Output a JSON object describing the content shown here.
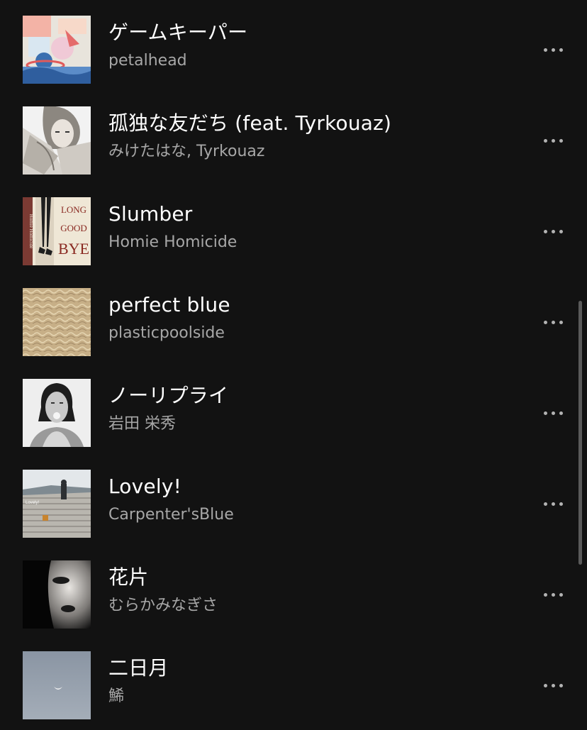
{
  "tracks": [
    {
      "title": "ゲームキーパー",
      "artist": "petalhead",
      "cover": "pastel-illustration-cover"
    },
    {
      "title": "孤独な友だち (feat. Tyrkouaz)",
      "artist": "みけたはな, Tyrkouaz",
      "cover": "anime-girl-cover"
    },
    {
      "title": "Slumber",
      "artist": "Homie Homicide",
      "cover": "long-good-bye-cover",
      "cover_text": {
        "line1": "LONG",
        "line2": "GOOD",
        "line3": "BYE",
        "side": "Homie Homicide"
      }
    },
    {
      "title": "perfect blue",
      "artist": "plasticpoolside",
      "cover": "water-ripple-cover"
    },
    {
      "title": "ノーリプライ",
      "artist": "岩田 栄秀",
      "cover": "portrait-bw-cover"
    },
    {
      "title": "Lovely!",
      "artist": "Carpenter'sBlue",
      "cover": "stairs-photo-cover",
      "cover_text": {
        "label": "Lovely!"
      }
    },
    {
      "title": "花片",
      "artist": "むらかみなぎさ",
      "cover": "eye-closeup-cover"
    },
    {
      "title": "二日月",
      "artist": "鯑",
      "cover": "crescent-moon-sky-cover"
    }
  ],
  "more_icon": "more-options-icon",
  "colors": {
    "background": "#121212",
    "title": "#ffffff",
    "subtitle": "#a7a7a7",
    "icon": "#b3b3b3"
  }
}
